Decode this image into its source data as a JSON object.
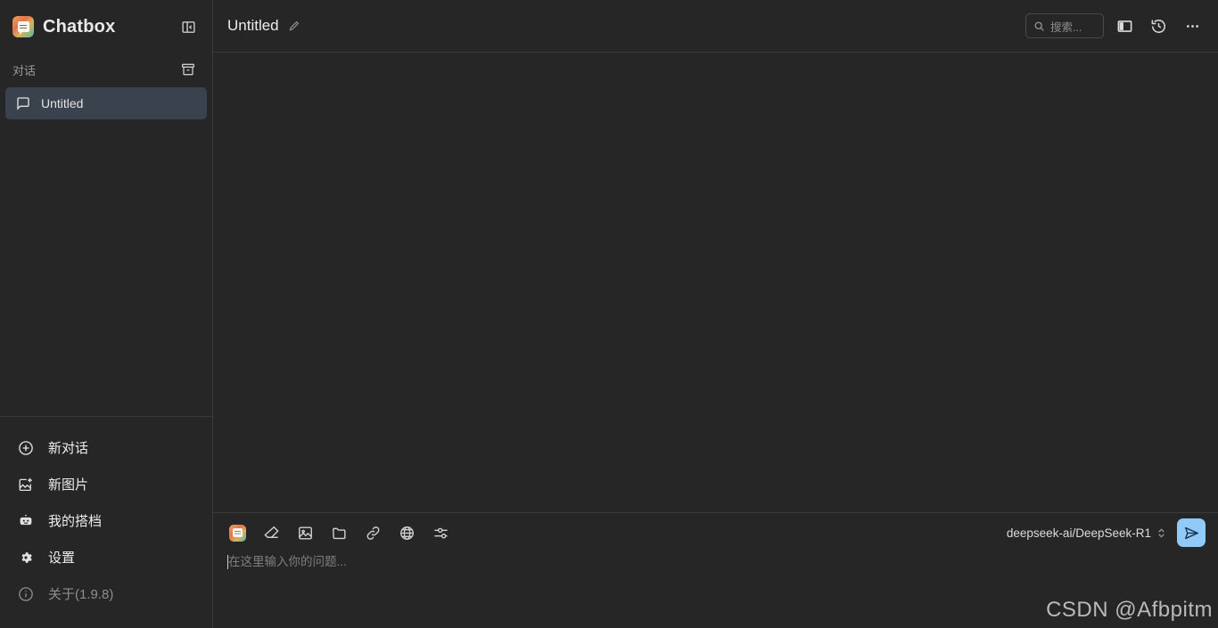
{
  "app": {
    "brand": "Chatbox"
  },
  "sidebar": {
    "collapse_icon": "panel-collapse-icon",
    "section": {
      "label": "对话",
      "archive_icon": "archive-icon"
    },
    "chats": [
      {
        "label": "Untitled",
        "icon": "message-square-icon",
        "active": true
      }
    ],
    "nav": [
      {
        "label": "新对话",
        "icon": "plus-circle-icon",
        "muted": false
      },
      {
        "label": "新图片",
        "icon": "image-plus-icon",
        "muted": false
      },
      {
        "label": "我的搭档",
        "icon": "robot-icon",
        "muted": false
      },
      {
        "label": "设置",
        "icon": "gear-icon",
        "muted": false
      },
      {
        "label": "关于(1.9.8)",
        "icon": "info-circle-icon",
        "muted": true
      }
    ]
  },
  "topbar": {
    "title": "Untitled",
    "edit_icon": "pencil-icon",
    "search": {
      "placeholder": "搜索...",
      "icon": "search-icon"
    },
    "actions": [
      {
        "icon": "split-panel-icon"
      },
      {
        "icon": "history-icon"
      },
      {
        "icon": "more-horizontal-icon"
      }
    ]
  },
  "composer": {
    "tools": [
      {
        "icon": "chatbox-logo-icon"
      },
      {
        "icon": "eraser-icon"
      },
      {
        "icon": "image-icon"
      },
      {
        "icon": "folder-icon"
      },
      {
        "icon": "link-icon"
      },
      {
        "icon": "globe-icon"
      },
      {
        "icon": "sliders-icon"
      }
    ],
    "input_placeholder": "在这里输入你的问题...",
    "model": "deepseek-ai/DeepSeek-R1",
    "model_chevron_icon": "chevron-up-down-icon",
    "send_icon": "send-icon"
  },
  "watermark": "CSDN @Afbpitm",
  "colors": {
    "sidebar_bg": "#262626",
    "main_bg": "#262626",
    "active_item": "#3a424d",
    "accent_send": "#90caf9",
    "border": "#3a3a3a"
  }
}
